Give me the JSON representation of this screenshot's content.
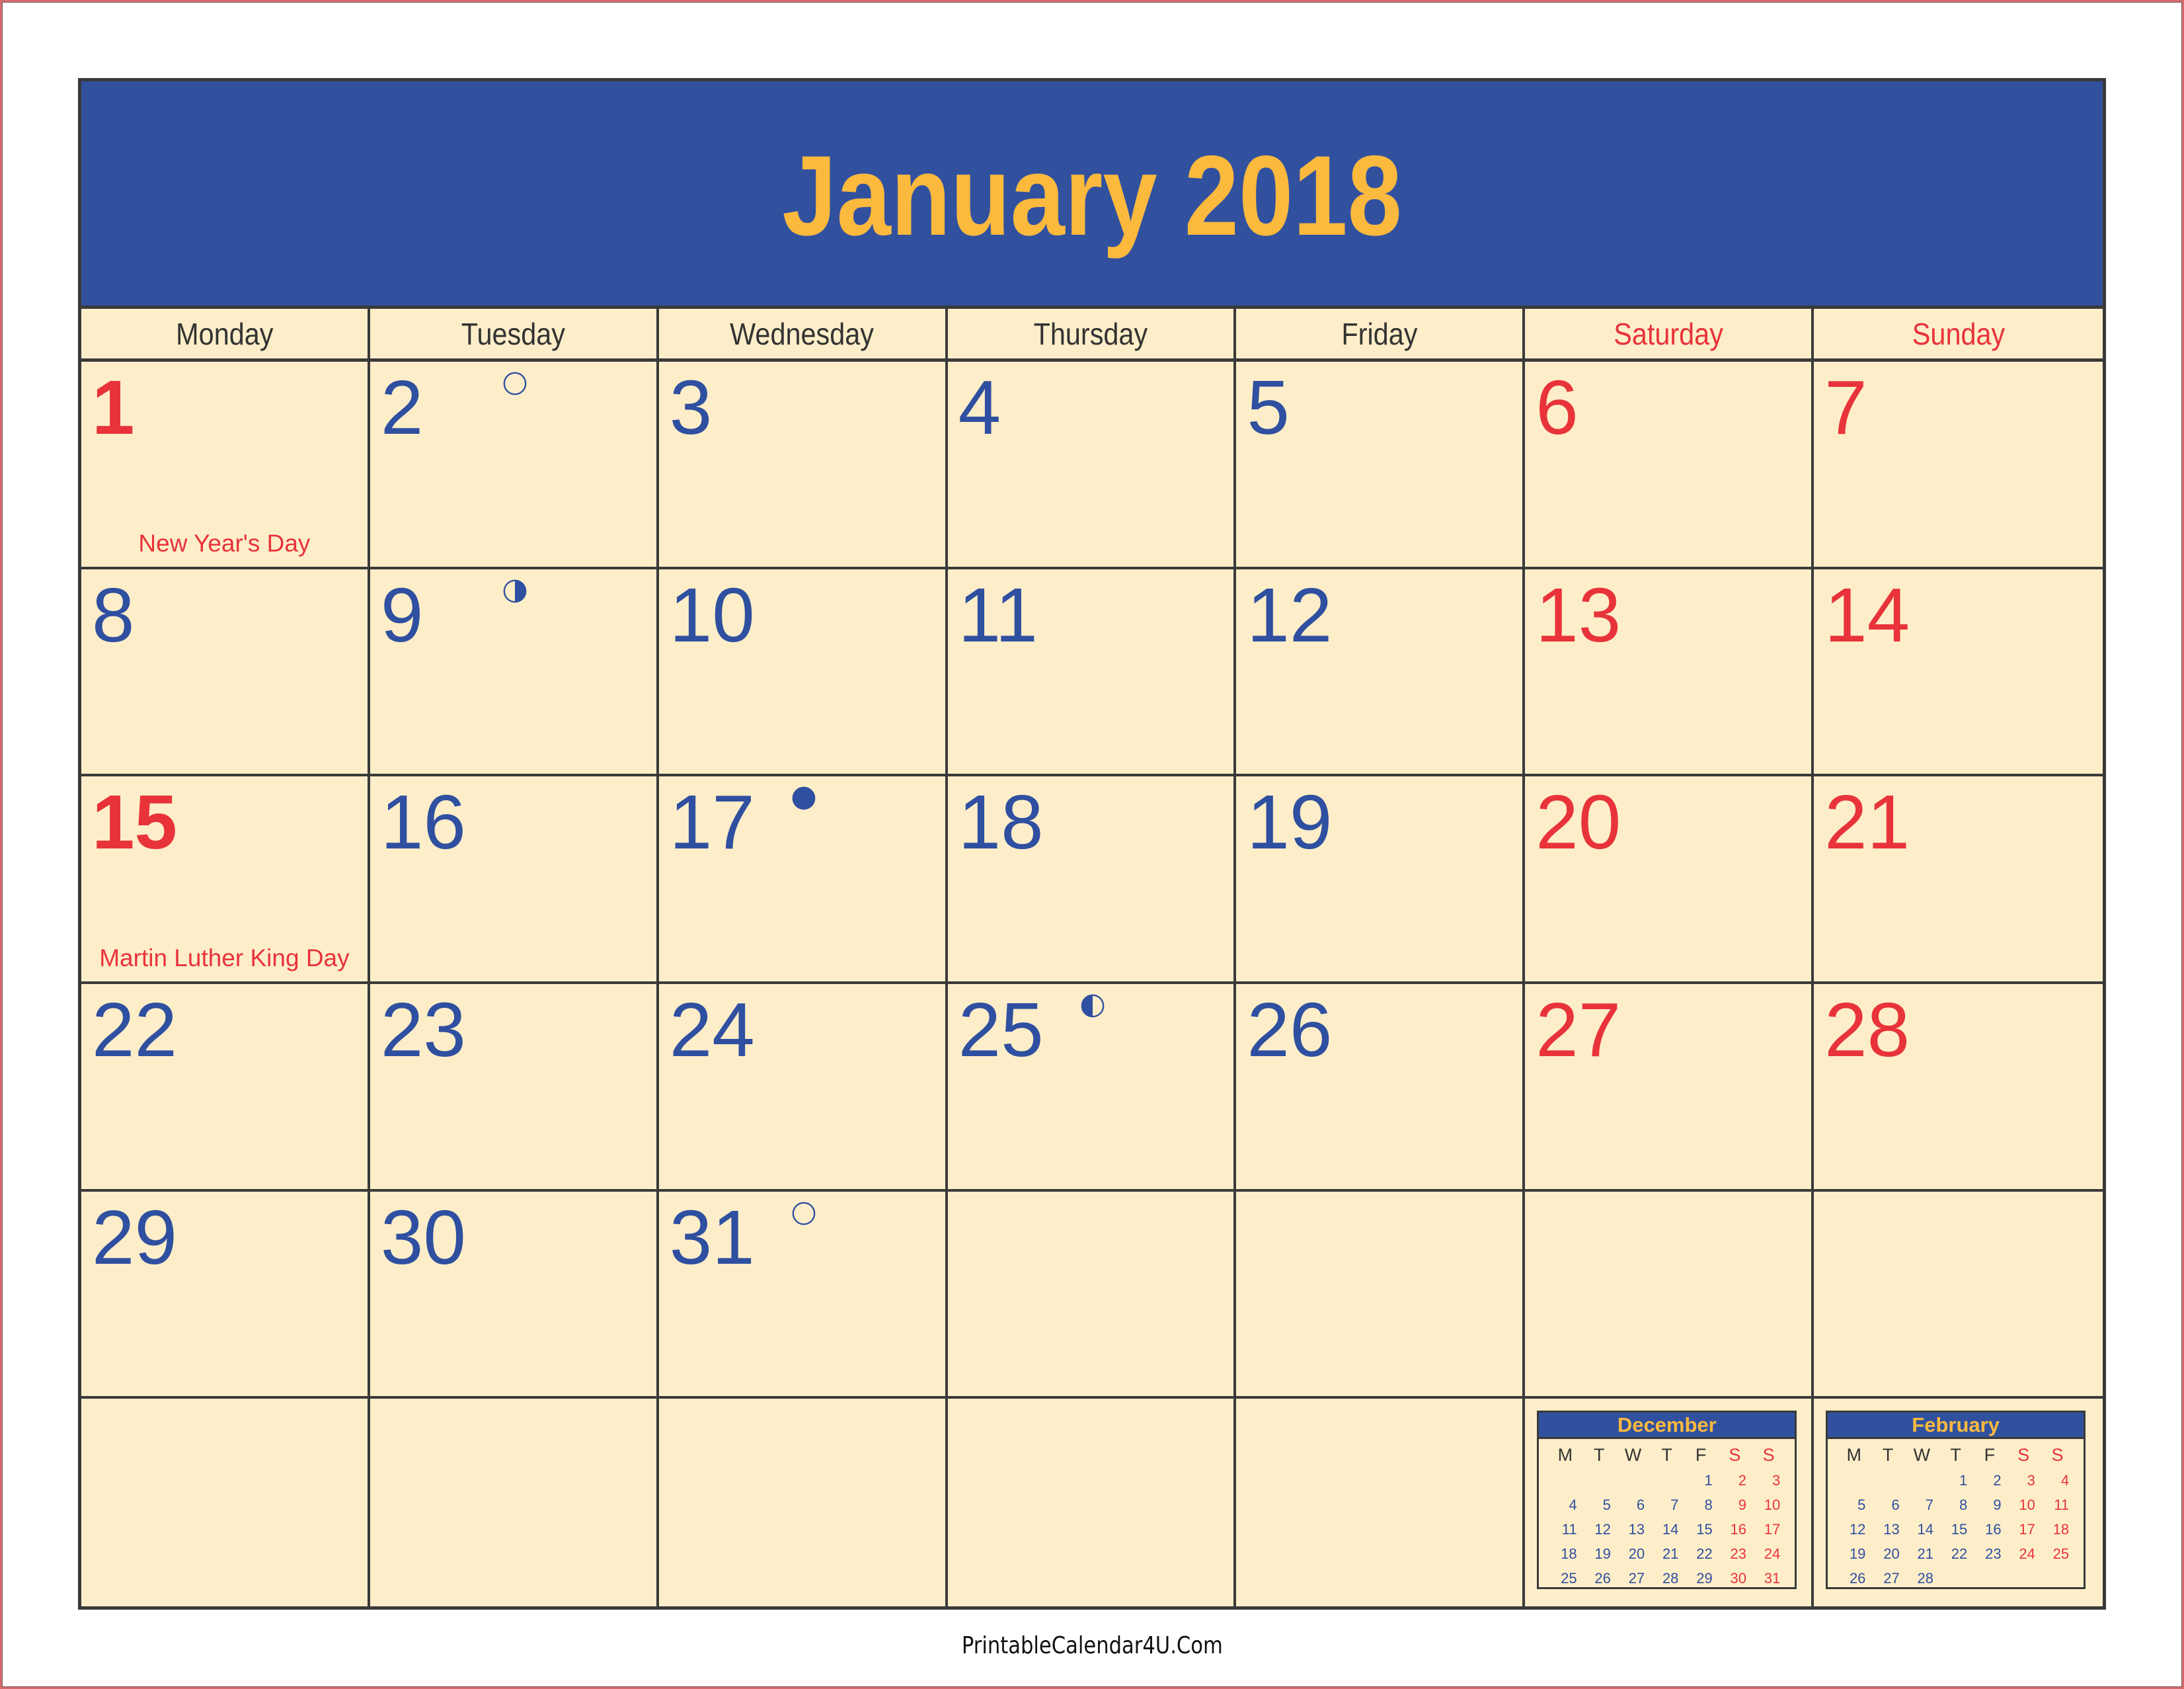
{
  "title": "January 2018",
  "colors": {
    "header_bg": "#31519f",
    "title_text": "#fbb93e",
    "cell_bg": "#fdeec9",
    "weekday_text": "#2f4fa0",
    "weekend_text": "#e8333a",
    "grid_line": "#3a3a3a",
    "page_border": "#d46a6f"
  },
  "weekdays": [
    {
      "label": "Monday",
      "weekend": false
    },
    {
      "label": "Tuesday",
      "weekend": false
    },
    {
      "label": "Wednesday",
      "weekend": false
    },
    {
      "label": "Thursday",
      "weekend": false
    },
    {
      "label": "Friday",
      "weekend": false
    },
    {
      "label": "Saturday",
      "weekend": true
    },
    {
      "label": "Sunday",
      "weekend": true
    }
  ],
  "first_weekday_index": 0,
  "days_in_month": 31,
  "holidays": [
    {
      "day": 1,
      "label": "New Year's Day"
    },
    {
      "day": 15,
      "label": "Martin Luther King Day"
    }
  ],
  "moon_phases": [
    {
      "day": 2,
      "phase": "full-moon"
    },
    {
      "day": 9,
      "phase": "last-quarter"
    },
    {
      "day": 17,
      "phase": "new-moon"
    },
    {
      "day": 25,
      "phase": "first-quarter"
    },
    {
      "day": 31,
      "phase": "full-moon"
    }
  ],
  "mini_calendars": [
    {
      "name": "December",
      "day_headers": [
        "M",
        "T",
        "W",
        "T",
        "F",
        "S",
        "S"
      ],
      "first_weekday_index": 4,
      "days": 31
    },
    {
      "name": "February",
      "day_headers": [
        "M",
        "T",
        "W",
        "T",
        "F",
        "S",
        "S"
      ],
      "first_weekday_index": 3,
      "days": 28
    }
  ],
  "footer": "PrintableCalendar4U.Com"
}
